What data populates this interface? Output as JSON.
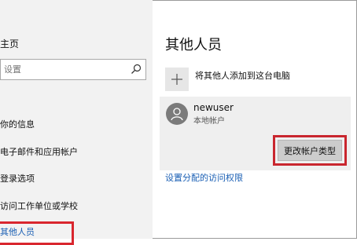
{
  "sidebar": {
    "home_label": "主页",
    "search": {
      "placeholder": "设置"
    },
    "items": [
      {
        "label": "你的信息"
      },
      {
        "label": "电子邮件和应用帐户"
      },
      {
        "label": "登录选项"
      },
      {
        "label": "访问工作单位或学校"
      },
      {
        "label": "其他人员",
        "selected": true
      }
    ]
  },
  "main": {
    "title": "其他人员",
    "add_label": "将其他人添加到这台电脑",
    "user": {
      "name": "newuser",
      "type": "本地帐户"
    },
    "change_type_button": "更改帐户类型",
    "assigned_access_link": "设置分配的访问权限"
  },
  "colors": {
    "accent": "#1a5fb4",
    "highlight_box": "#d9262e"
  },
  "icons": {
    "search": "search-icon",
    "add": "plus-icon",
    "avatar": "person-icon"
  }
}
